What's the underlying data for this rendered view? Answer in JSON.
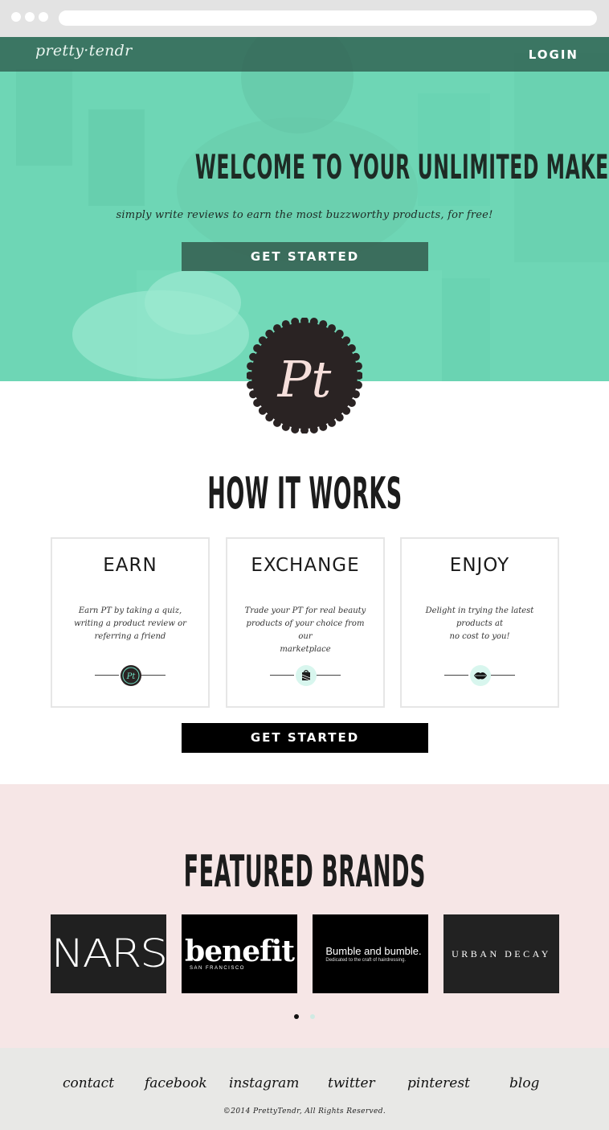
{
  "header": {
    "logo": "pretty·tendr",
    "login_label": "LOGIN"
  },
  "hero": {
    "title": "WELCOME TO YOUR UNLIMITED MAKEUP BAG",
    "subtitle": "simply write reviews to earn the most buzzworthy products, for free!",
    "cta_label": "GET STARTED",
    "badge_text": "Pt"
  },
  "how_it_works": {
    "title": "HOW IT WORKS",
    "cards": [
      {
        "title": "EARN",
        "line1": "Earn PT by taking a quiz,",
        "line2": "writing a product review or",
        "line3": "referring a friend",
        "icon": "pt-coin-icon"
      },
      {
        "title": "EXCHANGE",
        "line1": "Trade your PT for real beauty",
        "line2": "products of your choice from our",
        "line3": "marketplace",
        "icon": "gift-icon"
      },
      {
        "title": "ENJOY",
        "line1": "Delight in trying the latest",
        "line2": "products at",
        "line3": "no cost to you!",
        "icon": "lips-icon"
      }
    ],
    "cta_label": "GET STARTED"
  },
  "featured_brands": {
    "title": "FEATURED BRANDS",
    "brands": [
      {
        "name": "NARS"
      },
      {
        "name": "benefit",
        "sub": "SAN FRANCISCO"
      },
      {
        "name": "Bumble and bumble.",
        "sub": "Dedicated to the craft of hairdressing."
      },
      {
        "name": "URBAN DECAY"
      }
    ],
    "pager": {
      "active": 0,
      "count": 2
    }
  },
  "footer": {
    "links": [
      "contact",
      "facebook",
      "instagram",
      "twitter",
      "pinterest",
      "blog"
    ],
    "copyright": "©2014 PrettyTendr, All Rights Reserved."
  },
  "colors": {
    "hero_mint": "#78d7b9",
    "nav_dark": "#2f5a4d",
    "brands_bg": "#f6e6e6",
    "footer_bg": "#e8e8e6",
    "badge_dark": "#2a2323",
    "accent_mint": "#6fe3c6"
  }
}
